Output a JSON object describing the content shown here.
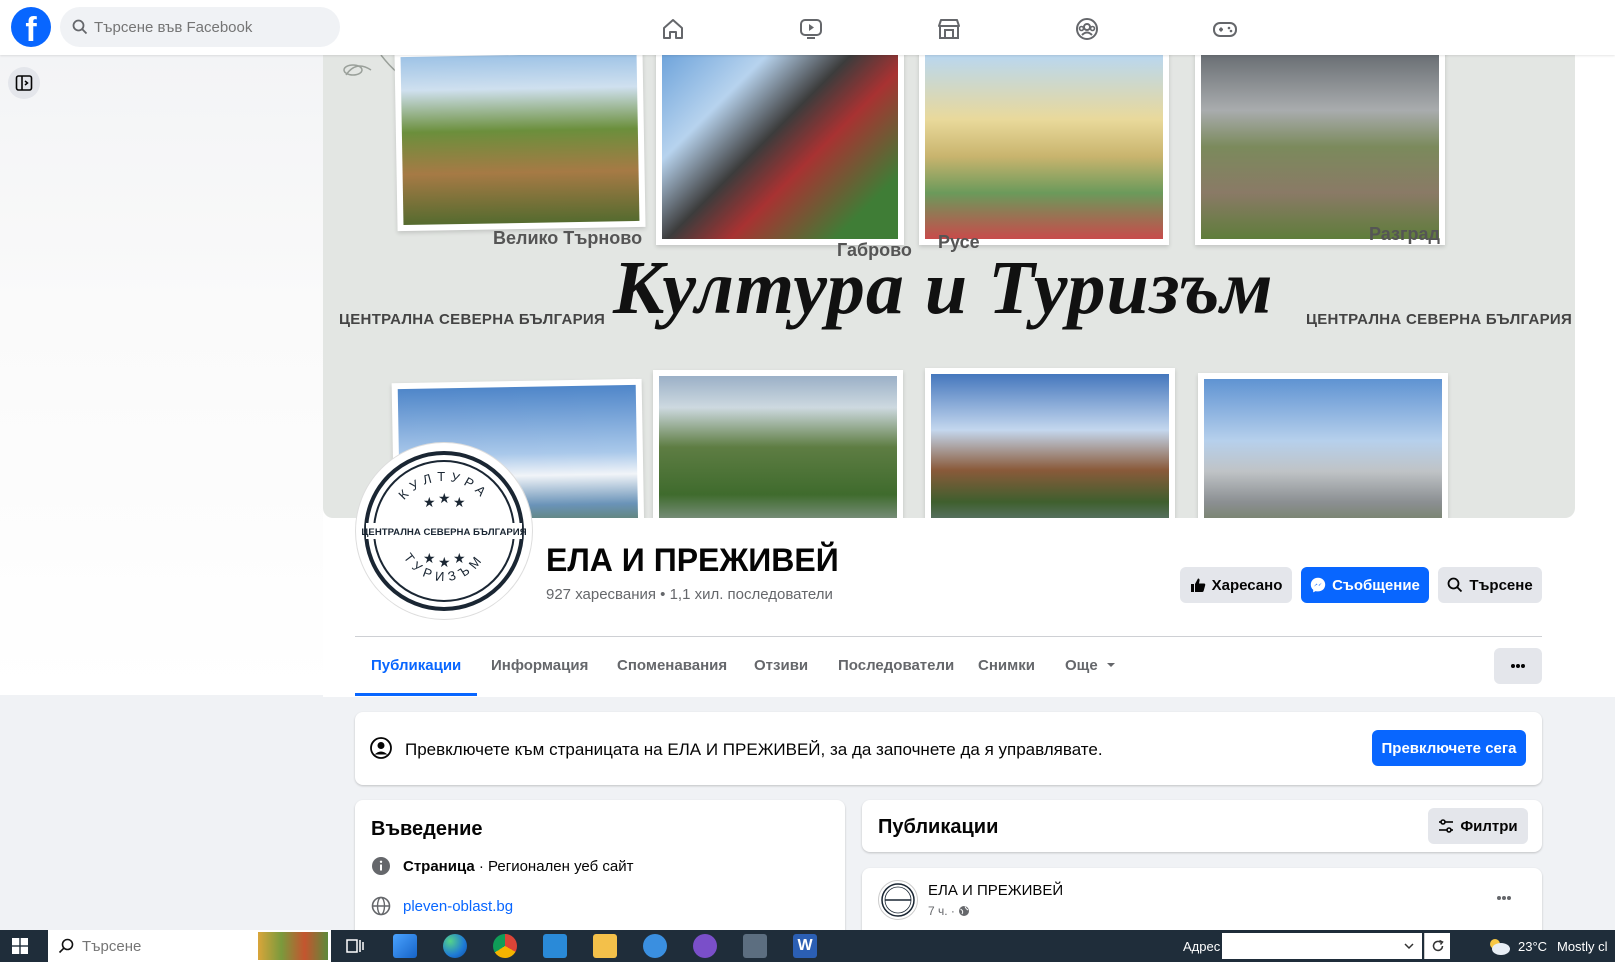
{
  "header": {
    "search_placeholder": "Търсене във Facebook"
  },
  "cover": {
    "cities": [
      "Велико Търново",
      "Габрово",
      "Русе",
      "Разград"
    ],
    "region_left": "ЦЕНТРАЛНА СЕВЕРНА БЪЛГАРИЯ",
    "region_right": "ЦЕНТРАЛНА СЕВЕРНА БЪЛГАРИЯ",
    "title": "Култура и Туризъм"
  },
  "avatar": {
    "top_text": "КУЛТУРА",
    "middle_text": "ЦЕНТРАЛНА СЕВЕРНА БЪЛГАРИЯ",
    "bottom_text": "ТУРИЗЪМ"
  },
  "profile": {
    "name": "ЕЛА И ПРЕЖИВЕЙ",
    "stats": "927 харесвания • 1,1 хил. последователи"
  },
  "actions": {
    "liked": "Харесано",
    "message": "Съобщение",
    "search": "Търсене"
  },
  "tabs": [
    {
      "label": "Публикации",
      "active": true
    },
    {
      "label": "Информация"
    },
    {
      "label": "Споменавания"
    },
    {
      "label": "Отзиви"
    },
    {
      "label": "Последователи"
    },
    {
      "label": "Снимки"
    },
    {
      "label": "Още"
    }
  ],
  "switch_banner": {
    "text": "Превключете към страницата на ЕЛА И ПРЕЖИВЕЙ, за да започнете да я управлявате.",
    "button": "Превключете сега"
  },
  "intro": {
    "title": "Въведение",
    "category_strong": "Страница",
    "category_rest": " · Регионален уеб сайт",
    "website": "pleven-oblast.bg"
  },
  "posts": {
    "title": "Публикации",
    "filters": "Филтри",
    "first_author": "ЕЛА И ПРЕЖИВЕЙ",
    "first_time": "7 ч. ·"
  },
  "taskbar": {
    "search_placeholder": "Търсене",
    "address_label": "Адрес",
    "weather_temp": "23°C",
    "weather_text": "Mostly cl"
  },
  "colors": {
    "brand_blue": "#0866ff",
    "taskbar": "#1f2d3a"
  }
}
